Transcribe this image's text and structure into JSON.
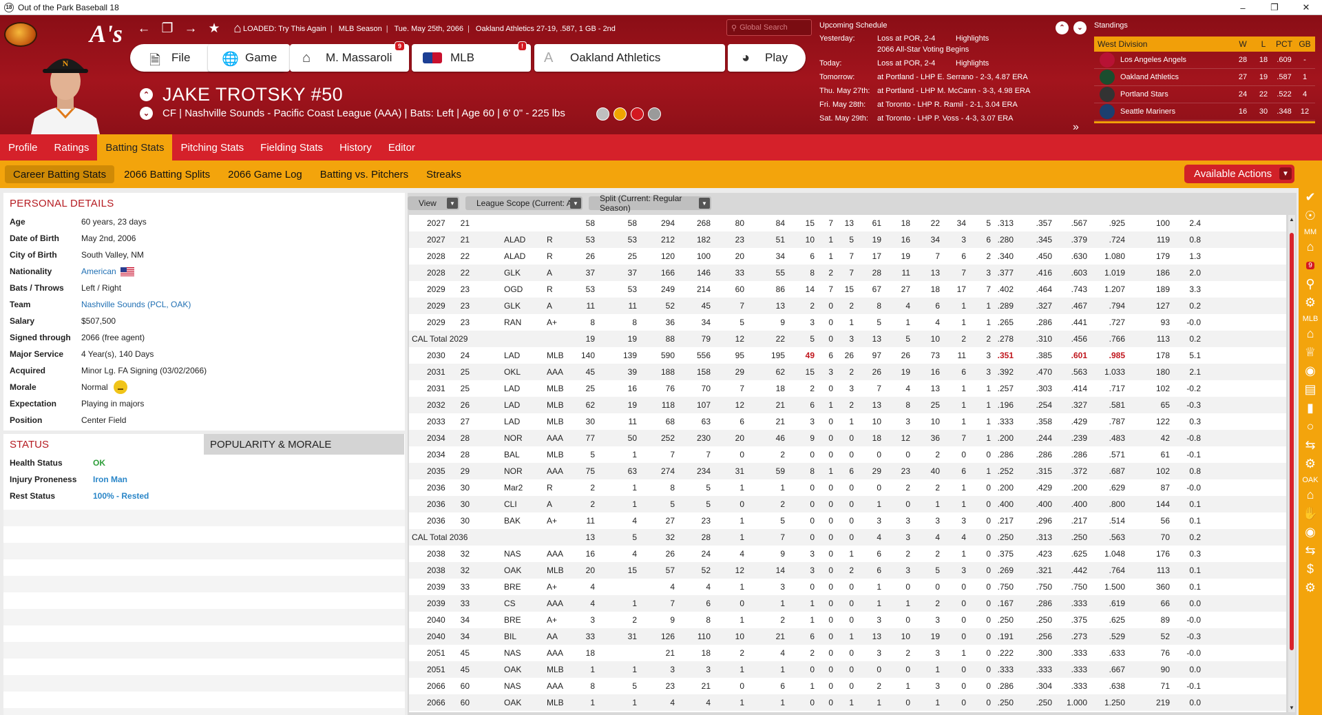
{
  "window": {
    "title": "Out of the Park Baseball 18",
    "icon": "18"
  },
  "header": {
    "loaded": "LOADED: Try This Again",
    "league": "MLB Season",
    "date": "Tue. May 25th, 2066",
    "team_record": "Oakland Athletics  27-19, .587, 1 GB - 2nd",
    "search_placeholder": "Global Search",
    "buttons": {
      "file": "File",
      "game": "Game",
      "manager": "M. Massaroli",
      "manager_badge": "9",
      "mlb": "MLB",
      "mlb_badge": "!",
      "team": "Oakland Athletics",
      "play": "Play"
    }
  },
  "player": {
    "name": "JAKE TROTSKY  #50",
    "line": "CF | Nashville Sounds - Pacific Coast League (AAA)  |  Bats: Left  |  Age 60  |  6' 0\" - 225 lbs"
  },
  "schedule": {
    "title": "Upcoming Schedule",
    "rows": [
      {
        "label": "Yesterday:",
        "result": "Loss at POR, 2-4",
        "extra": "Highlights"
      },
      {
        "label": "",
        "result": "2066 All-Star Voting Begins",
        "extra": ""
      },
      {
        "label": "Today:",
        "result": "Loss at POR, 2-4",
        "extra": "Highlights"
      },
      {
        "label": "Tomorrow:",
        "result": "at Portland - LHP E. Serrano - 2-3, 4.87 ERA",
        "extra": ""
      },
      {
        "label": "Thu. May 27th:",
        "result": "at Portland - LHP M. McCann - 3-3, 4.98 ERA",
        "extra": ""
      },
      {
        "label": "Fri. May 28th:",
        "result": "at Toronto - LHP R. Ramil - 2-1, 3.04 ERA",
        "extra": ""
      },
      {
        "label": "Sat. May 29th:",
        "result": "at Toronto - LHP P. Voss - 4-3, 3.07 ERA",
        "extra": ""
      }
    ]
  },
  "standings": {
    "title": "Standings",
    "division": "West Division",
    "cols": [
      "W",
      "L",
      "PCT",
      "GB"
    ],
    "teams": [
      {
        "name": "Los Angeles Angels",
        "w": "28",
        "l": "18",
        "pct": ".609",
        "gb": "-",
        "color": "#b71234"
      },
      {
        "name": "Oakland Athletics",
        "w": "27",
        "l": "19",
        "pct": ".587",
        "gb": "1",
        "color": "#1b4d2e"
      },
      {
        "name": "Portland Stars",
        "w": "24",
        "l": "22",
        "pct": ".522",
        "gb": "4",
        "color": "#333333"
      },
      {
        "name": "Seattle Mariners",
        "w": "16",
        "l": "30",
        "pct": ".348",
        "gb": "12",
        "color": "#1c3f6e"
      }
    ]
  },
  "tabs": [
    "Profile",
    "Ratings",
    "Batting Stats",
    "Pitching Stats",
    "Fielding Stats",
    "History",
    "Editor"
  ],
  "subtabs": [
    "Career Batting Stats",
    "2066 Batting Splits",
    "2066 Game Log",
    "Batting vs. Pitchers",
    "Streaks"
  ],
  "available_actions": "Available Actions",
  "personal": {
    "title": "PERSONAL DETAILS",
    "rows": [
      {
        "k": "Age",
        "v": "60 years, 23 days"
      },
      {
        "k": "Date of Birth",
        "v": "May 2nd, 2006"
      },
      {
        "k": "City of Birth",
        "v": "South Valley, NM"
      },
      {
        "k": "Nationality",
        "v": "American"
      },
      {
        "k": "Bats / Throws",
        "v": "Left / Right"
      },
      {
        "k": "Team",
        "v": "Nashville Sounds (PCL, OAK)"
      },
      {
        "k": "Salary",
        "v": "$507,500"
      },
      {
        "k": "Signed through",
        "v": "2066 (free agent)"
      },
      {
        "k": "Major Service",
        "v": "4 Year(s), 140 Days"
      },
      {
        "k": "Acquired",
        "v": "Minor Lg. FA Signing (03/02/2066)"
      },
      {
        "k": "Morale",
        "v": "Normal"
      },
      {
        "k": "Expectation",
        "v": "Playing in majors"
      },
      {
        "k": "Position",
        "v": "Center Field"
      }
    ]
  },
  "status": {
    "tab_active": "STATUS",
    "tab_other": "POPULARITY & MORALE",
    "rows": [
      {
        "k": "Health Status",
        "v": "OK",
        "color": "#2e9e3a"
      },
      {
        "k": "Injury Proneness",
        "v": "Iron Man",
        "color": "#2a86c8"
      },
      {
        "k": "Rest Status",
        "v": "100% - Rested",
        "color": "#2a86c8"
      }
    ]
  },
  "filters": [
    {
      "label": "View"
    },
    {
      "label": "League Scope  (Current: All)"
    },
    {
      "label": "Split  (Current: Regular Season)"
    }
  ],
  "stats_rows": [
    [
      "2027",
      "21",
      "",
      "",
      "58",
      "58",
      "294",
      "268",
      "80",
      "84",
      "15",
      "7",
      "13",
      "61",
      "18",
      "22",
      "34",
      "5",
      ".313",
      ".357",
      ".567",
      ".925",
      "100",
      "2.4"
    ],
    [
      "2027",
      "21",
      "ALAD",
      "R",
      "53",
      "53",
      "212",
      "182",
      "23",
      "51",
      "10",
      "1",
      "5",
      "19",
      "16",
      "34",
      "3",
      "6",
      ".280",
      ".345",
      ".379",
      ".724",
      "119",
      "0.8"
    ],
    [
      "2028",
      "22",
      "ALAD",
      "R",
      "26",
      "25",
      "120",
      "100",
      "20",
      "34",
      "6",
      "1",
      "7",
      "17",
      "19",
      "7",
      "6",
      "2",
      ".340",
      ".450",
      ".630",
      "1.080",
      "179",
      "1.3"
    ],
    [
      "2028",
      "22",
      "GLK",
      "A",
      "37",
      "37",
      "166",
      "146",
      "33",
      "55",
      "8",
      "2",
      "7",
      "28",
      "11",
      "13",
      "7",
      "3",
      ".377",
      ".416",
      ".603",
      "1.019",
      "186",
      "2.0"
    ],
    [
      "2029",
      "23",
      "OGD",
      "R",
      "53",
      "53",
      "249",
      "214",
      "60",
      "86",
      "14",
      "7",
      "15",
      "67",
      "27",
      "18",
      "17",
      "7",
      ".402",
      ".464",
      ".743",
      "1.207",
      "189",
      "3.3"
    ],
    [
      "2029",
      "23",
      "GLK",
      "A",
      "11",
      "11",
      "52",
      "45",
      "7",
      "13",
      "2",
      "0",
      "2",
      "8",
      "4",
      "6",
      "1",
      "1",
      ".289",
      ".327",
      ".467",
      ".794",
      "127",
      "0.2"
    ],
    [
      "2029",
      "23",
      "RAN",
      "A+",
      "8",
      "8",
      "36",
      "34",
      "5",
      "9",
      "3",
      "0",
      "1",
      "5",
      "1",
      "4",
      "1",
      "1",
      ".265",
      ".286",
      ".441",
      ".727",
      "93",
      "-0.0"
    ],
    [
      "CAL Total 2029",
      "",
      "",
      "",
      "19",
      "19",
      "88",
      "79",
      "12",
      "22",
      "5",
      "0",
      "3",
      "13",
      "5",
      "10",
      "2",
      "2",
      ".278",
      ".310",
      ".456",
      ".766",
      "113",
      "0.2"
    ],
    [
      "2030",
      "24",
      "LAD",
      "MLB",
      "140",
      "139",
      "590",
      "556",
      "95",
      "195",
      "49",
      "6",
      "26",
      "97",
      "26",
      "73",
      "11",
      "3",
      ".351",
      ".385",
      ".601",
      ".985",
      "178",
      "5.1"
    ],
    [
      "2031",
      "25",
      "OKL",
      "AAA",
      "45",
      "39",
      "188",
      "158",
      "29",
      "62",
      "15",
      "3",
      "2",
      "26",
      "19",
      "16",
      "6",
      "3",
      ".392",
      ".470",
      ".563",
      "1.033",
      "180",
      "2.1"
    ],
    [
      "2031",
      "25",
      "LAD",
      "MLB",
      "25",
      "16",
      "76",
      "70",
      "7",
      "18",
      "2",
      "0",
      "3",
      "7",
      "4",
      "13",
      "1",
      "1",
      ".257",
      ".303",
      ".414",
      ".717",
      "102",
      "-0.2"
    ],
    [
      "2032",
      "26",
      "LAD",
      "MLB",
      "62",
      "19",
      "118",
      "107",
      "12",
      "21",
      "6",
      "1",
      "2",
      "13",
      "8",
      "25",
      "1",
      "1",
      ".196",
      ".254",
      ".327",
      ".581",
      "65",
      "-0.3"
    ],
    [
      "2033",
      "27",
      "LAD",
      "MLB",
      "30",
      "11",
      "68",
      "63",
      "6",
      "21",
      "3",
      "0",
      "1",
      "10",
      "3",
      "10",
      "1",
      "1",
      ".333",
      ".358",
      ".429",
      ".787",
      "122",
      "0.3"
    ],
    [
      "2034",
      "28",
      "NOR",
      "AAA",
      "77",
      "50",
      "252",
      "230",
      "20",
      "46",
      "9",
      "0",
      "0",
      "18",
      "12",
      "36",
      "7",
      "1",
      ".200",
      ".244",
      ".239",
      ".483",
      "42",
      "-0.8"
    ],
    [
      "2034",
      "28",
      "BAL",
      "MLB",
      "5",
      "1",
      "7",
      "7",
      "0",
      "2",
      "0",
      "0",
      "0",
      "0",
      "0",
      "2",
      "0",
      "0",
      ".286",
      ".286",
      ".286",
      ".571",
      "61",
      "-0.1"
    ],
    [
      "2035",
      "29",
      "NOR",
      "AAA",
      "75",
      "63",
      "274",
      "234",
      "31",
      "59",
      "8",
      "1",
      "6",
      "29",
      "23",
      "40",
      "6",
      "1",
      ".252",
      ".315",
      ".372",
      ".687",
      "102",
      "0.8"
    ],
    [
      "2036",
      "30",
      "Mar2",
      "R",
      "2",
      "1",
      "8",
      "5",
      "1",
      "1",
      "0",
      "0",
      "0",
      "0",
      "2",
      "2",
      "1",
      "0",
      ".200",
      ".429",
      ".200",
      ".629",
      "87",
      "-0.0"
    ],
    [
      "2036",
      "30",
      "CLI",
      "A",
      "2",
      "1",
      "5",
      "5",
      "0",
      "2",
      "0",
      "0",
      "0",
      "1",
      "0",
      "1",
      "1",
      "0",
      ".400",
      ".400",
      ".400",
      ".800",
      "144",
      "0.1"
    ],
    [
      "2036",
      "30",
      "BAK",
      "A+",
      "11",
      "4",
      "27",
      "23",
      "1",
      "5",
      "0",
      "0",
      "0",
      "3",
      "3",
      "3",
      "3",
      "0",
      ".217",
      ".296",
      ".217",
      ".514",
      "56",
      "0.1"
    ],
    [
      "CAL Total 2036",
      "",
      "",
      "",
      "13",
      "5",
      "32",
      "28",
      "1",
      "7",
      "0",
      "0",
      "0",
      "4",
      "3",
      "4",
      "4",
      "0",
      ".250",
      ".313",
      ".250",
      ".563",
      "70",
      "0.2"
    ],
    [
      "2038",
      "32",
      "NAS",
      "AAA",
      "16",
      "4",
      "26",
      "24",
      "4",
      "9",
      "3",
      "0",
      "1",
      "6",
      "2",
      "2",
      "1",
      "0",
      ".375",
      ".423",
      ".625",
      "1.048",
      "176",
      "0.3"
    ],
    [
      "2038",
      "32",
      "OAK",
      "MLB",
      "20",
      "15",
      "57",
      "52",
      "12",
      "14",
      "3",
      "0",
      "2",
      "6",
      "3",
      "5",
      "3",
      "0",
      ".269",
      ".321",
      ".442",
      ".764",
      "113",
      "0.1"
    ],
    [
      "2039",
      "33",
      "BRE",
      "A+",
      "4",
      "",
      "4",
      "4",
      "1",
      "3",
      "0",
      "0",
      "0",
      "1",
      "0",
      "0",
      "0",
      "0",
      ".750",
      ".750",
      ".750",
      "1.500",
      "360",
      "0.1"
    ],
    [
      "2039",
      "33",
      "CS",
      "AAA",
      "4",
      "1",
      "7",
      "6",
      "0",
      "1",
      "1",
      "0",
      "0",
      "1",
      "1",
      "2",
      "0",
      "0",
      ".167",
      ".286",
      ".333",
      ".619",
      "66",
      "0.0"
    ],
    [
      "2040",
      "34",
      "BRE",
      "A+",
      "3",
      "2",
      "9",
      "8",
      "1",
      "2",
      "1",
      "0",
      "0",
      "3",
      "0",
      "3",
      "0",
      "0",
      ".250",
      ".250",
      ".375",
      ".625",
      "89",
      "-0.0"
    ],
    [
      "2040",
      "34",
      "BIL",
      "AA",
      "33",
      "31",
      "126",
      "110",
      "10",
      "21",
      "6",
      "0",
      "1",
      "13",
      "10",
      "19",
      "0",
      "0",
      ".191",
      ".256",
      ".273",
      ".529",
      "52",
      "-0.3"
    ],
    [
      "2051",
      "45",
      "NAS",
      "AAA",
      "18",
      "",
      "21",
      "18",
      "2",
      "4",
      "2",
      "0",
      "0",
      "3",
      "2",
      "3",
      "1",
      "0",
      ".222",
      ".300",
      ".333",
      ".633",
      "76",
      "-0.0"
    ],
    [
      "2051",
      "45",
      "OAK",
      "MLB",
      "1",
      "1",
      "3",
      "3",
      "1",
      "1",
      "0",
      "0",
      "0",
      "0",
      "0",
      "1",
      "0",
      "0",
      ".333",
      ".333",
      ".333",
      ".667",
      "90",
      "0.0"
    ],
    [
      "2066",
      "60",
      "NAS",
      "AAA",
      "8",
      "5",
      "23",
      "21",
      "0",
      "6",
      "1",
      "0",
      "0",
      "2",
      "1",
      "3",
      "0",
      "0",
      ".286",
      ".304",
      ".333",
      ".638",
      "71",
      "-0.1"
    ],
    [
      "2066",
      "60",
      "OAK",
      "MLB",
      "1",
      "1",
      "4",
      "4",
      "1",
      "1",
      "0",
      "0",
      "1",
      "1",
      "0",
      "1",
      "0",
      "0",
      ".250",
      ".250",
      "1.000",
      "1.250",
      "219",
      "0.0"
    ]
  ],
  "highlight_cells": [
    [
      8,
      10
    ],
    [
      8,
      18
    ],
    [
      8,
      20
    ],
    [
      8,
      21
    ]
  ],
  "sidebar_labels": [
    "MM",
    "MLB",
    "OAK"
  ],
  "sidebar_badge": "9",
  "colors": {
    "header_red": "#a3141d",
    "tab_red": "#d5212a",
    "accent_orange": "#f3a40c",
    "link_blue": "#1f6fb3",
    "highlight_red": "#c0161d"
  }
}
